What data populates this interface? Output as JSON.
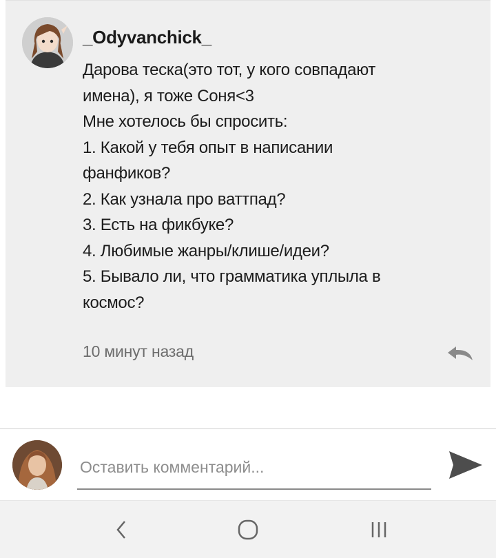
{
  "comment": {
    "username": "_Odyvanchick_",
    "lines": [
      "Дарова теска(это тот, у кого совпадают",
      "имена), я тоже Соня<3",
      "Мне хотелось бы спросить:",
      "1. Какой у тебя опыт в написании",
      "фанфиков?",
      "2. Как узнала про ваттпад?",
      "3. Есть на фикбуке?",
      "4. Любимые жанры/клише/идеи?",
      "5. Бывало ли, что грамматика уплыла в",
      "космос?"
    ],
    "timestamp": "10 минут назад"
  },
  "composer": {
    "placeholder": "Оставить комментарий..."
  },
  "icons": {
    "reply": "reply-arrow-icon",
    "send": "send-icon",
    "back": "back-chevron-icon",
    "home": "home-circle-icon",
    "recents": "recents-lines-icon"
  },
  "colors": {
    "card_bg": "#efefef",
    "text": "#1c1c1c",
    "muted": "#6d6d6d",
    "nav_bg": "#f2f2f2"
  }
}
